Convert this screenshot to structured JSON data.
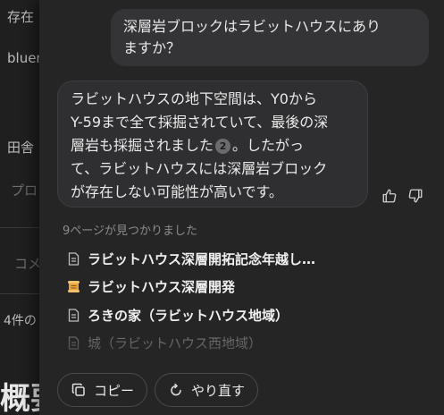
{
  "background": {
    "texts": [
      "存在",
      "bluer",
      "田舎",
      "プロ",
      "コメ",
      "4件の"
    ],
    "heading": "概要"
  },
  "chat": {
    "user_message_line1": "深層岩ブロックはラビットハウスにあり",
    "user_message_line2": "ますか？",
    "ai_line1": "ラビットハウスの地下空間は、Y0から",
    "ai_line2": "Y-59まで全て採掘されていて、最後の深",
    "ai_line3a": "層岩も採掘されました",
    "ai_citation": "2",
    "ai_line3b": "。したがっ",
    "ai_line4": "て、ラビットハウスには深層岩ブロック",
    "ai_line5": "が存在しない可能性が高いです。"
  },
  "sources": {
    "header": "9ページが見つかりました",
    "items": [
      {
        "label": "ラビットハウス深層開拓記念年越し…",
        "icon": "document-icon"
      },
      {
        "label": "ラビットハウス深層開発",
        "icon": "scroll-icon"
      },
      {
        "label": "ろきの家（ラビットハウス地域）",
        "icon": "document-icon"
      },
      {
        "label": "城（ラビットハウス西地域）",
        "icon": "document-icon"
      }
    ]
  },
  "actions": {
    "copy_label": "コピー",
    "retry_label": "やり直す"
  },
  "colors": {
    "panel": "#252526",
    "bubble": "#2f2f31",
    "scroll_icon": "#e8a33c"
  }
}
